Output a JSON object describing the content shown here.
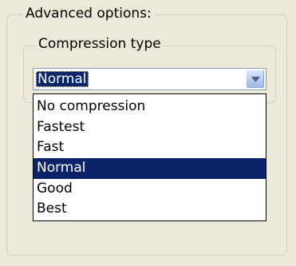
{
  "advanced_group": {
    "legend": "Advanced options:"
  },
  "compression_group": {
    "legend": "Compression type",
    "combo": {
      "value": "Normal",
      "button_icon": "chevron-down-icon"
    },
    "dropdown": {
      "options": [
        {
          "label": "No compression",
          "selected": false
        },
        {
          "label": "Fastest",
          "selected": false
        },
        {
          "label": "Fast",
          "selected": false
        },
        {
          "label": "Normal",
          "selected": true
        },
        {
          "label": "Good",
          "selected": false
        },
        {
          "label": "Best",
          "selected": false
        }
      ]
    }
  },
  "colors": {
    "background": "#ece9d8",
    "selection": "#0a246a",
    "group_border": "#d0d0bf",
    "combo_border": "#7f9db9"
  }
}
